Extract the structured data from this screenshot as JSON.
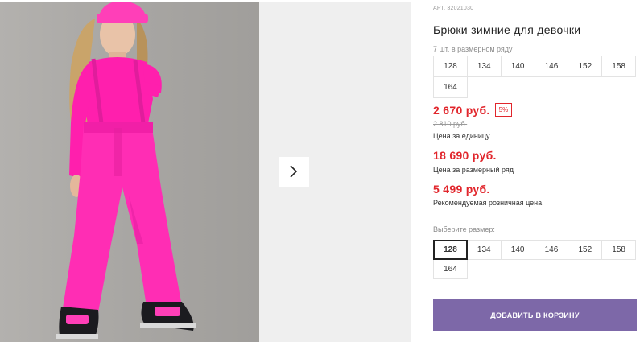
{
  "gallery": {
    "next_icon": "chevron-right-icon"
  },
  "product": {
    "article": "АРТ. 32021030",
    "title": "Брюки зимние для девочки",
    "size_count": "7 шт. в размерном ряду",
    "row_sizes": [
      "128",
      "134",
      "140",
      "146",
      "152",
      "158",
      "164"
    ],
    "price": "2 670 руб.",
    "discount": "5%",
    "old_price": "2 810 руб.",
    "price_caption": "Цена за единицу",
    "row_price": "18 690 руб.",
    "row_price_caption": "Цена за размерный ряд",
    "retail_price": "5 499 руб.",
    "retail_caption": "Рекомендуемая розничная цена",
    "choose_label": "Выберите размер:",
    "select_sizes": [
      "128",
      "134",
      "140",
      "146",
      "152",
      "158",
      "164"
    ],
    "selected_size": "128",
    "add_to_cart": "ДОБАВИТЬ В КОРЗИНУ"
  },
  "colors": {
    "price_red": "#e1262c",
    "button_purple": "#7d68a8",
    "garment_pink": "#ff2db4"
  }
}
